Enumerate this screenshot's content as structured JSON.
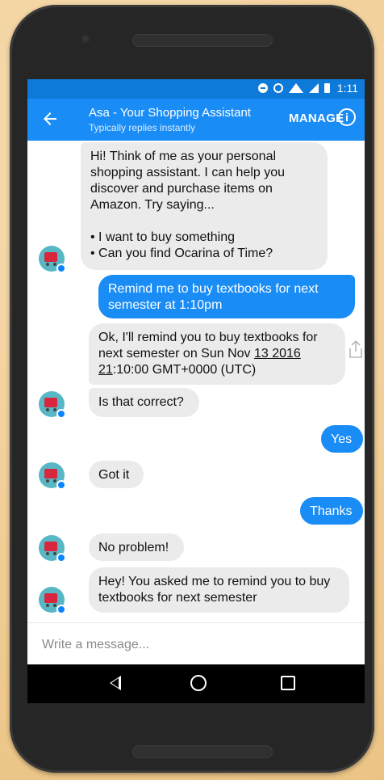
{
  "status_bar": {
    "time": "1:11",
    "icons": [
      "do-not-disturb-icon",
      "alarm-icon",
      "wifi-icon",
      "signal-icon",
      "battery-icon"
    ]
  },
  "app_bar": {
    "title": "Asa - Your Shopping Assistant",
    "subtitle": "Typically replies instantly",
    "manage_label": "MANAGE",
    "info_icon": "info-icon",
    "back_icon": "back-arrow-icon"
  },
  "messages": [
    {
      "sender": "bot",
      "lines": [
        "Hi! Think of me as your personal",
        "shopping assistant. I can help you",
        "discover and purchase items on",
        "Amazon. Try saying...",
        "",
        "• I want to buy something",
        "• Can you find Ocarina of Time?"
      ]
    },
    {
      "sender": "user",
      "lines": [
        "Remind me to buy textbooks for next",
        "semester at 1:10pm"
      ]
    },
    {
      "sender": "bot",
      "line1": "Ok, I'll remind you to buy textbooks for",
      "line2_prefix": "next semester on Sun Nov ",
      "line2_link": "13 2016",
      "line3_link": "21",
      "line3_suffix": ":10:00 GMT+0000 (UTC)"
    },
    {
      "sender": "bot",
      "text": "Is that correct?"
    },
    {
      "sender": "user",
      "text": "Yes"
    },
    {
      "sender": "bot",
      "text": "Got it"
    },
    {
      "sender": "user",
      "text": "Thanks"
    },
    {
      "sender": "bot",
      "text": "No problem!"
    },
    {
      "sender": "bot",
      "lines": [
        "Hey! You asked me to remind you to buy",
        "textbooks for next semester"
      ]
    }
  ],
  "composer": {
    "placeholder": "Write a message..."
  },
  "colors": {
    "accent": "#1a8cf5",
    "status_bar": "#0d7ad9",
    "bot_bubble": "#ebebeb",
    "avatar": "#58b7c4",
    "cart": "#d7263d"
  },
  "nav_bar": {
    "icons": [
      "nav-back-icon",
      "nav-home-icon",
      "nav-recents-icon"
    ]
  }
}
